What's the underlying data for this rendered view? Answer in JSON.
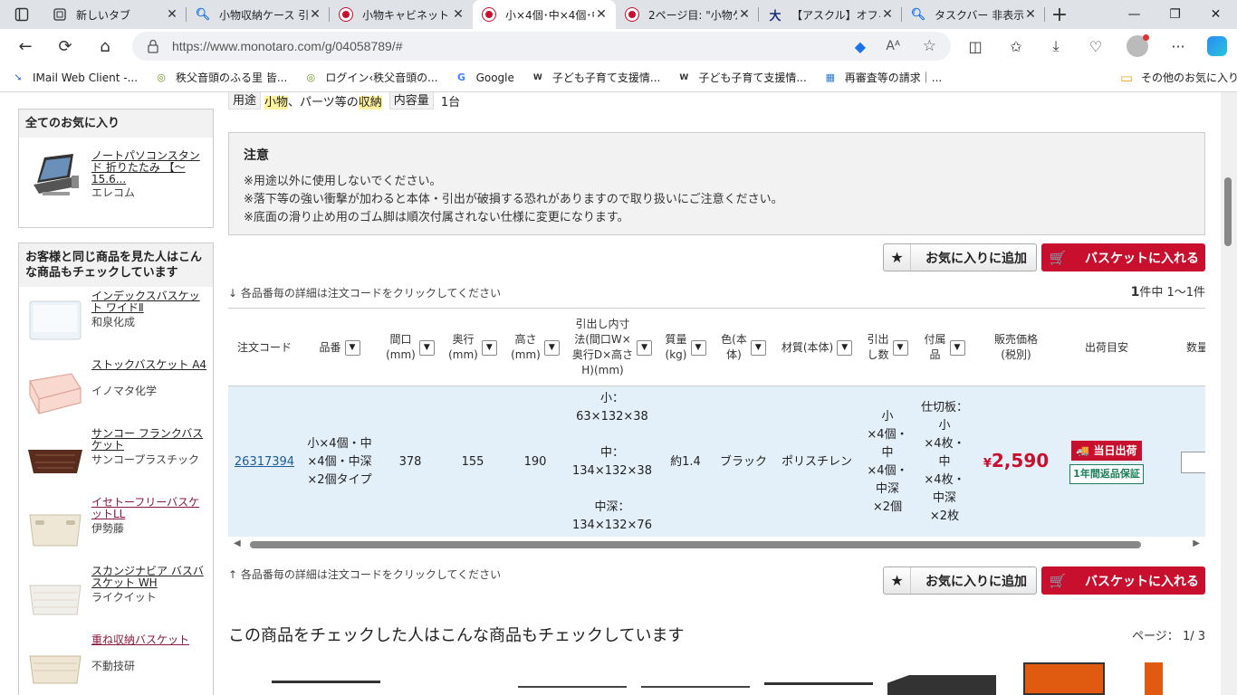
{
  "browser": {
    "tabs": [
      {
        "title": "新しいタブ",
        "icon": "new-tab-page-icon",
        "active": false
      },
      {
        "title": "小物収納ケース 引出",
        "icon": "search-icon",
        "active": false
      },
      {
        "title": "小物キャビネット ア",
        "icon": "monotaro-icon",
        "active": false
      },
      {
        "title": "小×4個･中×4個･中",
        "icon": "monotaro-icon",
        "active": true
      },
      {
        "title": "2ページ目: \"小物ケー",
        "icon": "monotaro-icon",
        "active": false
      },
      {
        "title": "【アスクル】オフィス用",
        "icon": "askul-icon",
        "active": false
      },
      {
        "title": "タスクバー 非表示 -",
        "icon": "search-icon",
        "active": false
      }
    ],
    "url": "https://www.monotaro.com/g/04058789/#",
    "bookmarks": [
      {
        "label": "IMail Web Client -...",
        "icon": "mail-icon"
      },
      {
        "label": "秩父音頭のふる里 皆...",
        "icon": "globe-icon"
      },
      {
        "label": "ログイン‹秩父音頭の...",
        "icon": "globe-icon"
      },
      {
        "label": "Google",
        "icon": "google-icon"
      },
      {
        "label": "子ども子育て支援情...",
        "icon": "wam-icon"
      },
      {
        "label": "子ども子育て支援情...",
        "icon": "wam-icon"
      },
      {
        "label": "再審査等の請求｜...",
        "icon": "pattern-icon"
      }
    ],
    "other_bookmarks": "その他のお気に入り"
  },
  "sidebar": {
    "fav_title": "全てのお気に入り",
    "fav_item": {
      "name": "ノートパソコンスタンド 折りたたみ 【～15.6...",
      "maker": "エレコム"
    },
    "also_title": "お客様と同じ商品を見た人はこんな商品もチェックしています",
    "also_items": [
      {
        "name": "インデックスバスケット ワイドⅡ",
        "maker": "和泉化成",
        "visited": false
      },
      {
        "name": "ストックバスケット A4",
        "maker": "イノマタ化学",
        "visited": false
      },
      {
        "name": "サンコー フランクバスケット",
        "maker": "サンコープラスチック",
        "visited": false
      },
      {
        "name": "イセトーフリーバスケットLL",
        "maker": "伊勢藤",
        "visited": true
      },
      {
        "name": "スカンジナビア バスバスケット WH",
        "maker": "ライクイット",
        "visited": false
      },
      {
        "name": "重ね収納バスケット",
        "maker": "不動技研",
        "visited": true
      }
    ]
  },
  "spec": {
    "use_label": "用途",
    "use_value_pre": "小物",
    "use_value_mid": "、パーツ等の",
    "use_value_hl": "収納",
    "capacity_label": "内容量",
    "capacity_value": "1台"
  },
  "notice": {
    "title": "注意",
    "lines": [
      "※用途以外に使用しないでください。",
      "※落下等の強い衝撃が加わると本体・引出が破損する恐れがありますので取り扱いにご注意ください。",
      "※底面の滑り止め用のゴム脚は順次付属されない仕様に変更になります。"
    ]
  },
  "actions": {
    "fav_label": "お気に入りに追加",
    "cart_label": "バスケットに入れる",
    "hint_top": "各品番毎の詳細は注文コードをクリックしてください",
    "hint_bottom": "各品番毎の詳細は注文コードをクリックしてください"
  },
  "result_count": {
    "total": "1",
    "suffix": "件中 1〜1件"
  },
  "table": {
    "headers": [
      {
        "label": "注文コード",
        "filter": false
      },
      {
        "label": "品番",
        "filter": true
      },
      {
        "label": "間口\n(mm)",
        "filter": true
      },
      {
        "label": "奥行\n(mm)",
        "filter": true
      },
      {
        "label": "高さ\n(mm)",
        "filter": true
      },
      {
        "label": "引出し内寸\n法(間口W×\n奥行D×高さ\nH)(mm)",
        "filter": true
      },
      {
        "label": "質量\n(kg)",
        "filter": true
      },
      {
        "label": "色(本\n体)",
        "filter": true
      },
      {
        "label": "材質(本体)",
        "filter": true
      },
      {
        "label": "引出\nし数",
        "filter": true
      },
      {
        "label": "付属\n品",
        "filter": true
      },
      {
        "label": "販売価格\n(税別)",
        "filter": false
      },
      {
        "label": "出荷目安",
        "filter": false
      },
      {
        "label": "数量",
        "filter": false
      }
    ],
    "row": {
      "code": "26317394",
      "model": "小×4個・中\n×4個・中深\n×2個タイプ",
      "width": "378",
      "depth": "155",
      "height": "190",
      "inner": "小：\n63×132×38\n\n中：\n134×132×38\n\n中深：\n134×132×76",
      "weight": "約1.4",
      "color": "ブラック",
      "material": "ポリスチレン",
      "drawers": "小\n×4個・\n中\n×4個・\n中深\n×2個",
      "accessories": "仕切板：\n小\n×4枚・\n中\n×4枚・\n中深\n×2枚",
      "price_symbol": "¥",
      "price": "2,590",
      "ship_badge": "当日出荷",
      "warranty_badge": "1年間返品保証"
    }
  },
  "also_section": {
    "title": "この商品をチェックした人はこんな商品もチェックしています",
    "pager_label": "ページ：",
    "pager_value": "1/ 3"
  }
}
